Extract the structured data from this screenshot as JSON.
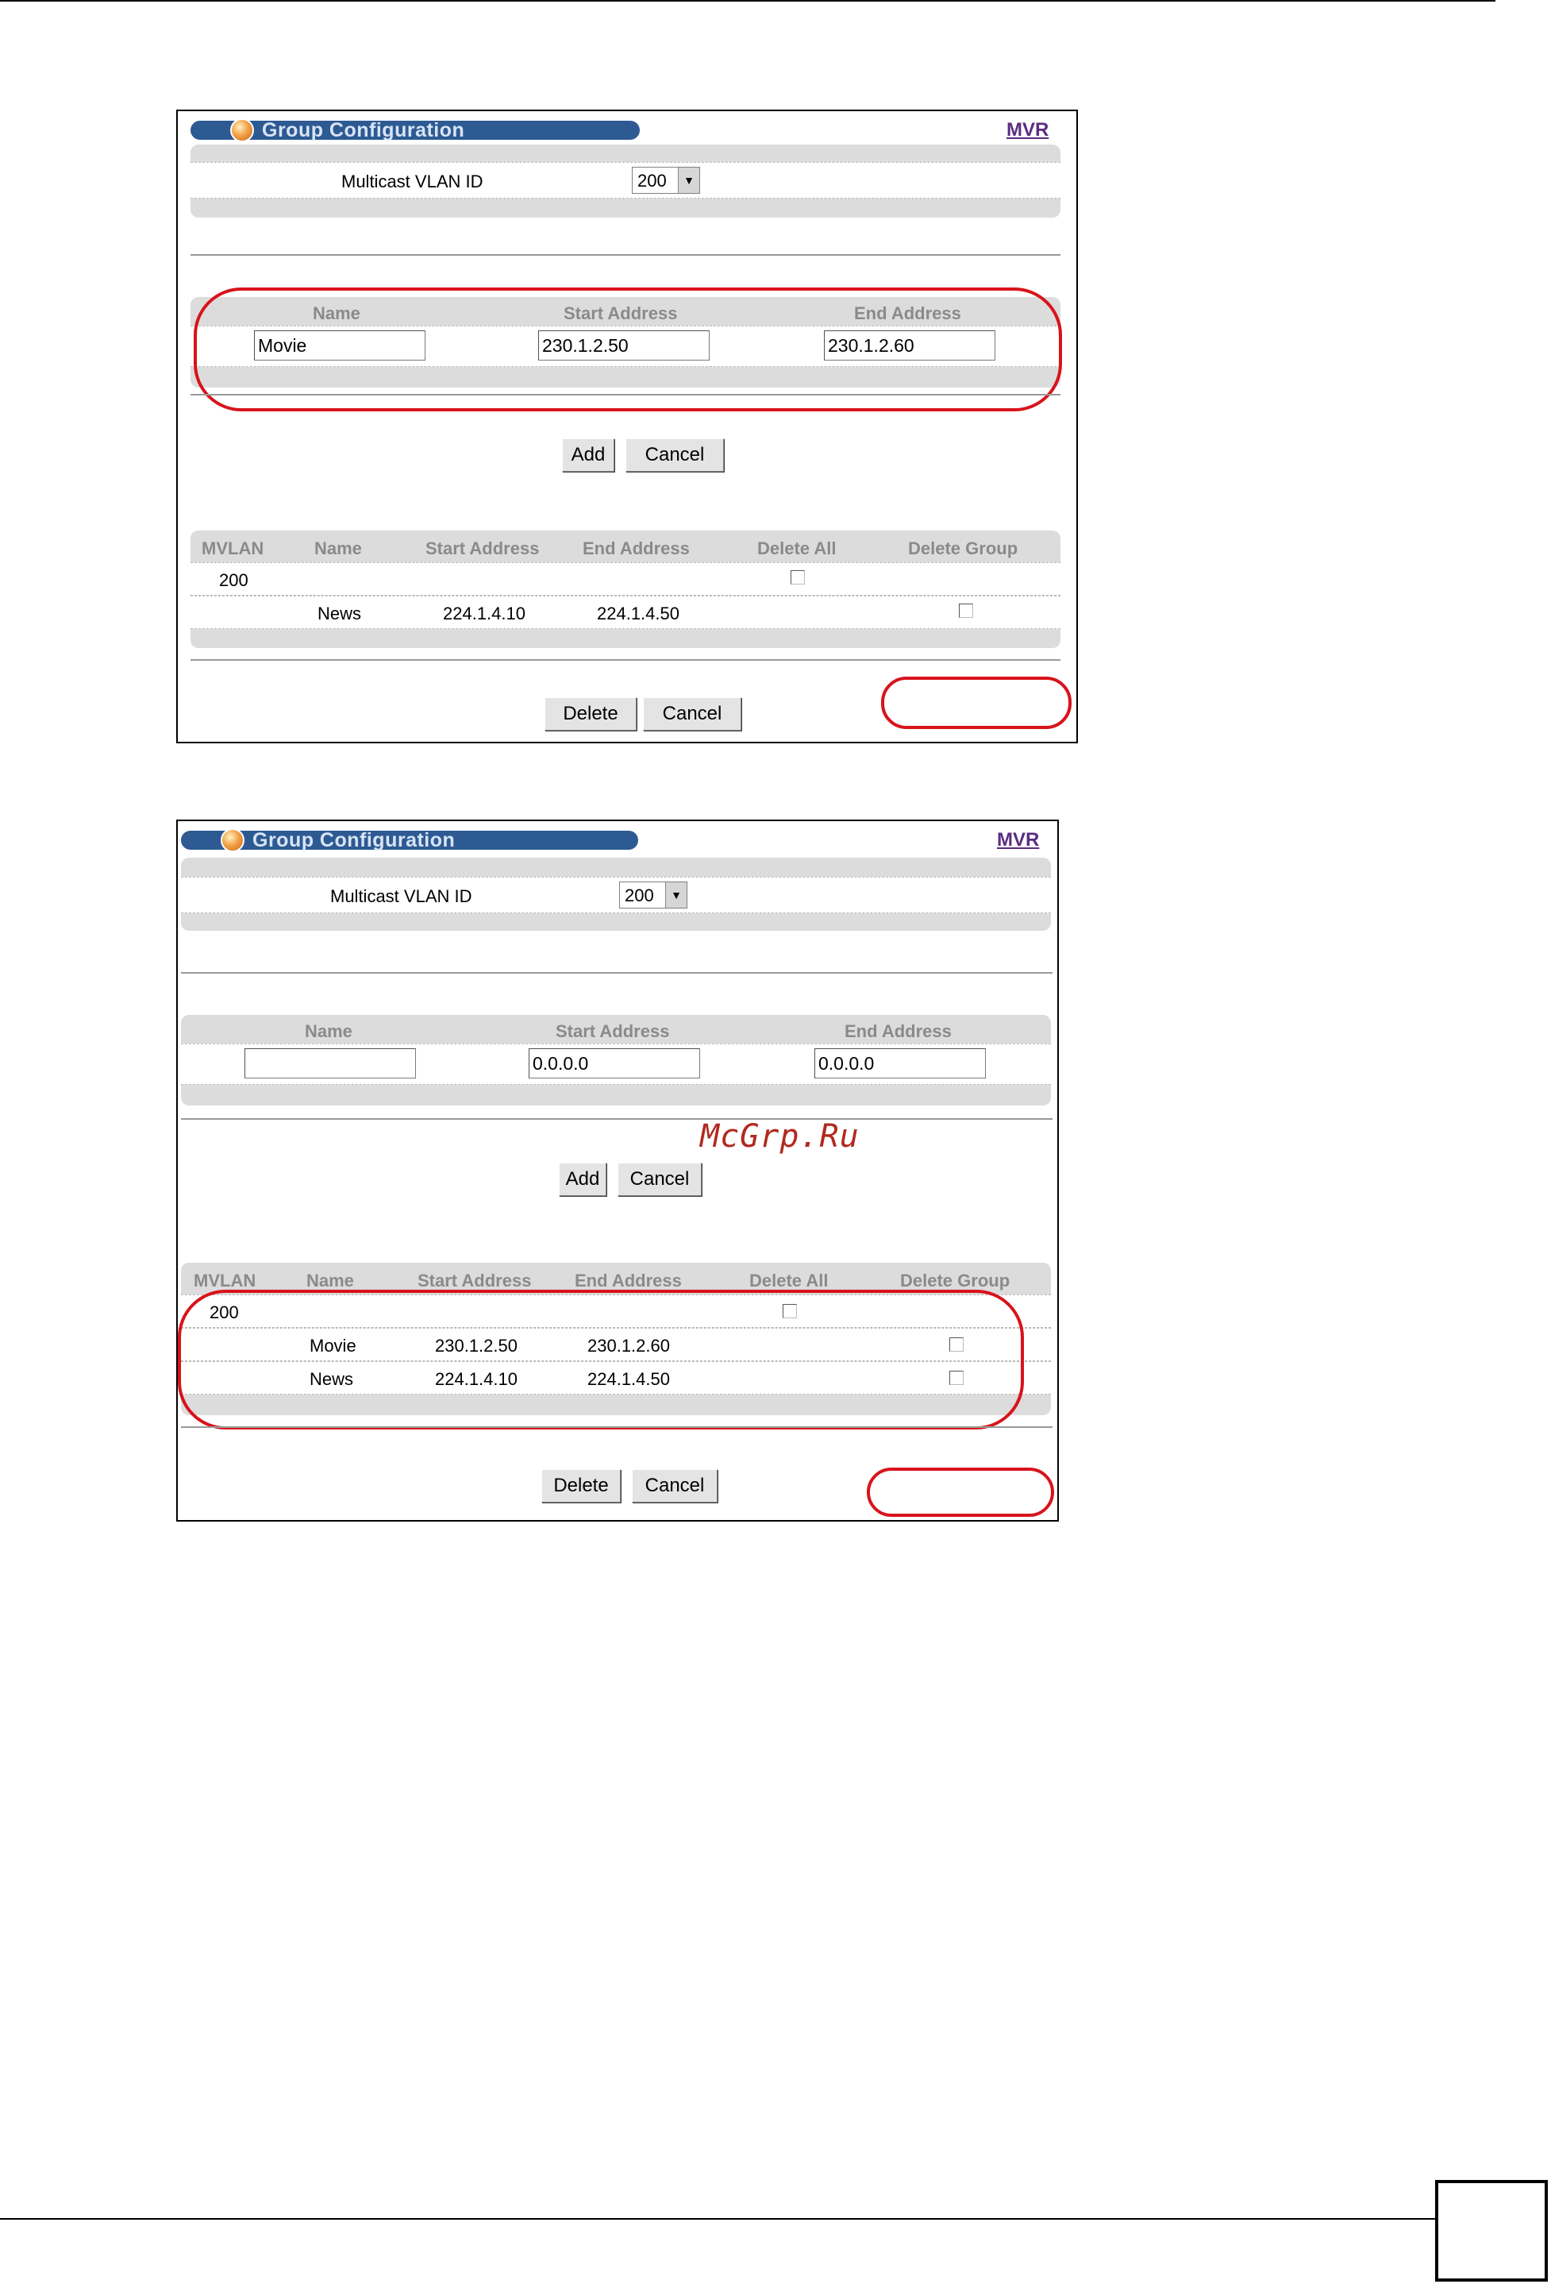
{
  "screen1": {
    "title": "Group Configuration",
    "mvr_link": "MVR",
    "multicast_vlan_label": "Multicast VLAN ID",
    "multicast_vlan_value": "200",
    "form_headers": {
      "name": "Name",
      "start": "Start Address",
      "end": "End Address"
    },
    "form_values": {
      "name": "Movie",
      "start": "230.1.2.50",
      "end": "230.1.2.60"
    },
    "add_label": "Add",
    "cancel_label": "Cancel",
    "table_headers": [
      "MVLAN",
      "Name",
      "Start Address",
      "End Address",
      "Delete All",
      "Delete Group"
    ],
    "mvlan_row": "200",
    "groups": [
      {
        "name": "News",
        "start": "224.1.4.10",
        "end": "224.1.4.50"
      }
    ],
    "delete_label": "Delete",
    "cancel2_label": "Cancel"
  },
  "screen2": {
    "title": "Group Configuration",
    "mvr_link": "MVR",
    "multicast_vlan_label": "Multicast VLAN ID",
    "multicast_vlan_value": "200",
    "form_headers": {
      "name": "Name",
      "start": "Start Address",
      "end": "End Address"
    },
    "form_values": {
      "name": "",
      "start": "0.0.0.0",
      "end": "0.0.0.0"
    },
    "add_label": "Add",
    "cancel_label": "Cancel",
    "table_headers": [
      "MVLAN",
      "Name",
      "Start Address",
      "End Address",
      "Delete All",
      "Delete Group"
    ],
    "mvlan_row": "200",
    "groups": [
      {
        "name": "Movie",
        "start": "230.1.2.50",
        "end": "230.1.2.60"
      },
      {
        "name": "News",
        "start": "224.1.4.10",
        "end": "224.1.4.50"
      }
    ],
    "delete_label": "Delete",
    "cancel2_label": "Cancel"
  },
  "watermark": "McGrp.Ru",
  "colors": {
    "annotation_red": "#d8131b",
    "title_bar": "#2d5a93",
    "link": "#5a2d82"
  }
}
